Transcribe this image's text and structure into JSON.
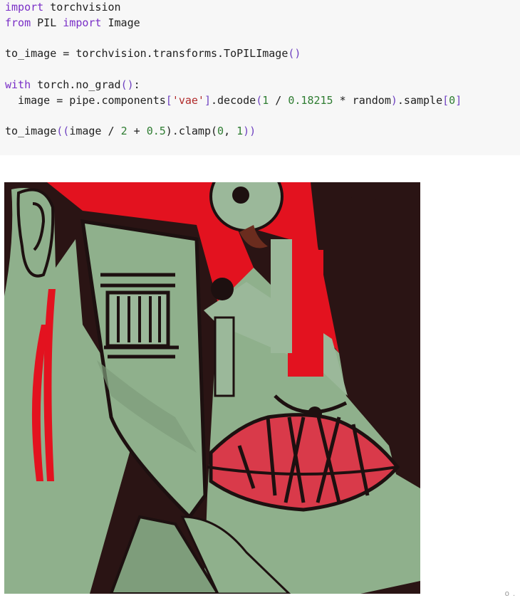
{
  "code_cell": {
    "lines": [
      {
        "tokens": [
          {
            "t": "import",
            "c": "kw"
          },
          {
            "t": " torchvision",
            "c": ""
          }
        ]
      },
      {
        "tokens": [
          {
            "t": "from",
            "c": "kw"
          },
          {
            "t": " PIL ",
            "c": ""
          },
          {
            "t": "import",
            "c": "kw"
          },
          {
            "t": " Image",
            "c": ""
          }
        ]
      },
      {
        "tokens": []
      },
      {
        "tokens": [
          {
            "t": "to_image = torchvision.transforms.ToPILImage",
            "c": ""
          },
          {
            "t": "()",
            "c": "br"
          }
        ]
      },
      {
        "tokens": []
      },
      {
        "tokens": [
          {
            "t": "with",
            "c": "kw"
          },
          {
            "t": " torch.no_grad",
            "c": ""
          },
          {
            "t": "()",
            "c": "br"
          },
          {
            "t": ":",
            "c": ""
          }
        ]
      },
      {
        "tokens": [
          {
            "t": "  image = pipe.components",
            "c": ""
          },
          {
            "t": "[",
            "c": "br"
          },
          {
            "t": "'vae'",
            "c": "str"
          },
          {
            "t": "]",
            "c": "br"
          },
          {
            "t": ".decode",
            "c": ""
          },
          {
            "t": "(",
            "c": "br"
          },
          {
            "t": "1",
            "c": "num"
          },
          {
            "t": " / ",
            "c": ""
          },
          {
            "t": "0.18215",
            "c": "num"
          },
          {
            "t": " * random",
            "c": ""
          },
          {
            "t": ")",
            "c": "br"
          },
          {
            "t": ".sample",
            "c": ""
          },
          {
            "t": "[",
            "c": "br"
          },
          {
            "t": "0",
            "c": "num"
          },
          {
            "t": "]",
            "c": "br"
          }
        ]
      },
      {
        "tokens": []
      },
      {
        "tokens": [
          {
            "t": "to_image",
            "c": ""
          },
          {
            "t": "((",
            "c": "br"
          },
          {
            "t": "image / ",
            "c": ""
          },
          {
            "t": "2",
            "c": "num"
          },
          {
            "t": " + ",
            "c": ""
          },
          {
            "t": "0.5",
            "c": "num"
          },
          {
            "t": ").clamp(",
            "c": ""
          },
          {
            "t": "0",
            "c": "num"
          },
          {
            "t": ", ",
            "c": ""
          },
          {
            "t": "1",
            "c": "num"
          },
          {
            "t": "))",
            "c": "br"
          }
        ]
      }
    ]
  },
  "output": {
    "image_description_icon": "generated-cubist-face-image"
  },
  "colors": {
    "cell_bg": "#f7f7f7",
    "keyword": "#7a2fc7",
    "string": "#b12a2a",
    "number": "#2f7d32",
    "bracket": "#6f42c1",
    "art_red": "#e3121f",
    "art_green": "#8fb08c",
    "art_dark": "#2a1414",
    "art_pink": "#d93a4a"
  },
  "footer": {
    "fragment": "o  .  "
  }
}
